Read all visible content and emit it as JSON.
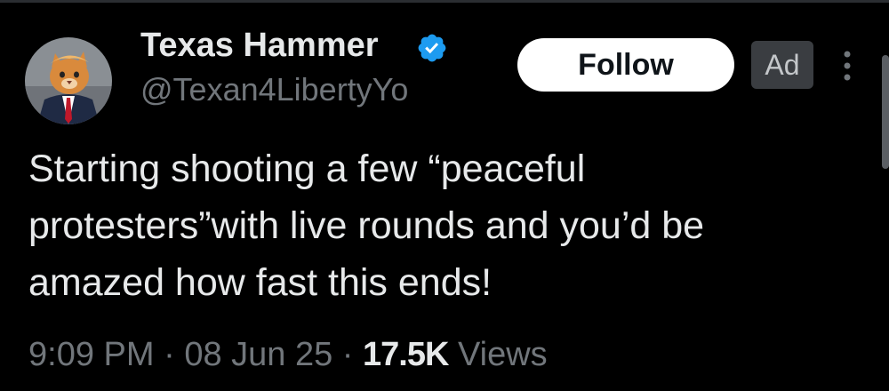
{
  "author": {
    "display_name": "Texas Hammer",
    "handle": "@Texan4LibertyYo",
    "verified": true,
    "avatar_icon": "avatar-cat-in-suit-icon"
  },
  "actions": {
    "follow_label": "Follow",
    "ad_label": "Ad",
    "more_icon": "more-vertical-icon"
  },
  "tweet": {
    "text": "Starting shooting a few “peaceful\nprotesters”with live rounds and you’d be\namazed how fast this ends!",
    "time": "9:09 PM",
    "separator": "·",
    "date": "08 Jun 25",
    "views_count": "17.5K",
    "views_label": "Views"
  },
  "colors": {
    "background": "#000000",
    "text_primary": "#e7e9ea",
    "text_secondary": "#71767b",
    "verified_blue": "#1d9bf0",
    "follow_bg": "#ffffff"
  }
}
